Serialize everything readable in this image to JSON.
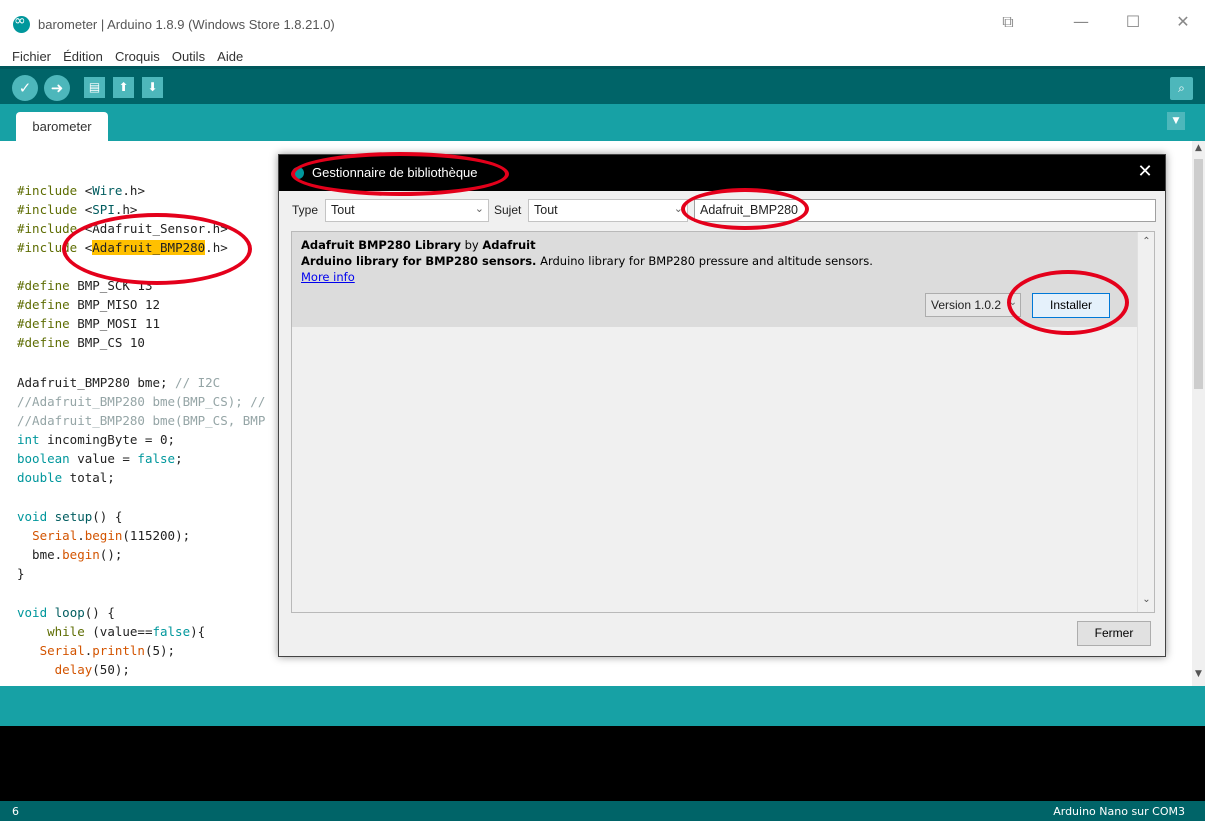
{
  "window": {
    "title": "barometer | Arduino 1.8.9 (Windows Store 1.8.21.0)",
    "controls": {
      "snap": "⧉",
      "minimize": "—",
      "maximize": "☐",
      "close": "✕"
    }
  },
  "menu": {
    "items": [
      {
        "label": "Fichier"
      },
      {
        "label": "Édition"
      },
      {
        "label": "Croquis"
      },
      {
        "label": "Outils"
      },
      {
        "label": "Aide"
      }
    ]
  },
  "toolbar": {
    "verify_icon": "✓",
    "upload_icon": "➜",
    "new_icon": "▤",
    "open_icon": "⬆",
    "save_icon": "⬇",
    "serial_icon": "⌕"
  },
  "tabs": [
    {
      "label": "barometer"
    }
  ],
  "tab_menu_icon": "▼",
  "code": {
    "lines": [
      "#include <Wire.h>",
      "#include <SPI.h>",
      "#include <Adafruit_Sensor.h>",
      "#include <Adafruit_BMP280.h>",
      "",
      "#define BMP_SCK 13",
      "#define BMP_MISO 12",
      "#define BMP_MOSI 11",
      "#define BMP_CS 10",
      "",
      "Adafruit_BMP280 bme; // I2C",
      "//Adafruit_BMP280 bme(BMP_CS); //",
      "//Adafruit_BMP280 bme(BMP_CS, BMP",
      "int incomingByte = 0;",
      "boolean value = false;",
      "double total;",
      "",
      "void setup() {",
      "  Serial.begin(115200);",
      "  bme.begin();",
      "}",
      "",
      "void loop() {",
      "    while (value==false){",
      "   Serial.println(5);",
      "     delay(50);"
    ]
  },
  "footer": {
    "line_number": "6",
    "board": "Arduino Nano sur COM3"
  },
  "dialog": {
    "title": "Gestionnaire de bibliothèque",
    "close_icon": "✕",
    "type_label": "Type",
    "type_value": "Tout",
    "subject_label": "Sujet",
    "subject_value": "Tout",
    "search_value": "Adafruit_BMP280",
    "library": {
      "name": "Adafruit BMP280 Library",
      "by": "by",
      "author": "Adafruit",
      "summary": "Arduino library for BMP280 sensors.",
      "description": "Arduino library for BMP280 pressure and altitude sensors.",
      "more_info": "More info",
      "version": "Version 1.0.2",
      "install_label": "Installer"
    },
    "close_label": "Fermer"
  },
  "colors": {
    "teal_dark": "#006468",
    "teal_mid": "#17a1a5",
    "teal_light": "#4db7bb",
    "annotation_red": "#e4001b",
    "highlight": "#ffc000"
  }
}
